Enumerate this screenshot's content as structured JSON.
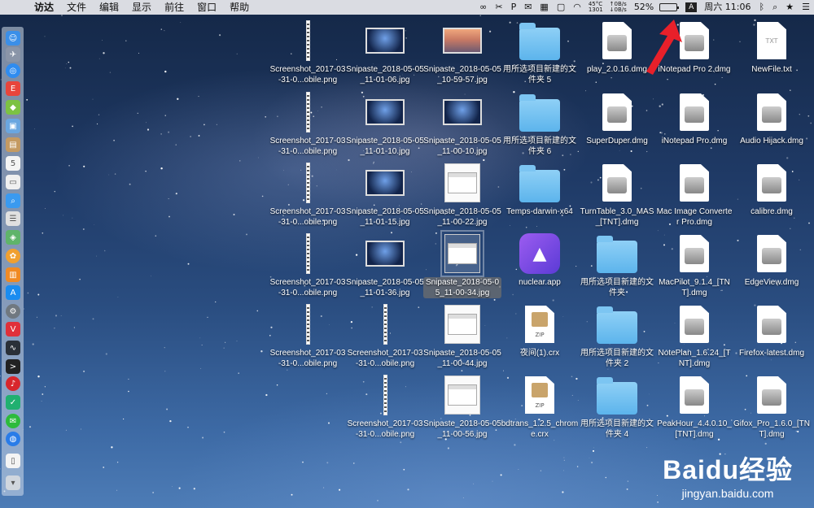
{
  "menubar": {
    "app_name": "访达",
    "menus": [
      "文件",
      "编辑",
      "显示",
      "前往",
      "窗口",
      "帮助"
    ],
    "status": {
      "temp_line1": "45°C",
      "temp_line2": "1301",
      "net_up": "↑0B/s",
      "net_down": "↓0B/s",
      "battery": "52%",
      "battery_level": 0.52,
      "input_method": "A",
      "clock": "周六 11:06"
    }
  },
  "desktop": {
    "items": [
      {
        "label": "Screenshot_2017-03-31-0...obile.png",
        "kind": "strip"
      },
      {
        "label": "Snipaste_2018-05-05_11-01-06.jpg",
        "kind": "shot"
      },
      {
        "label": "Snipaste_2018-05-05_10-59-57.jpg",
        "kind": "sierra"
      },
      {
        "label": "用所选项目新建的文件夹 5",
        "kind": "folder"
      },
      {
        "label": "play_2.0.16.dmg",
        "kind": "dmg"
      },
      {
        "label": "iNotepad Pro 2.dmg",
        "kind": "dmg"
      },
      {
        "label": "NewFile.txt",
        "kind": "txt"
      },
      {
        "label": "Screenshot_2017-03-31-0...obile.png",
        "kind": "strip"
      },
      {
        "label": "Snipaste_2018-05-05_11-01-10.jpg",
        "kind": "shot"
      },
      {
        "label": "Snipaste_2018-05-05_11-00-10.jpg",
        "kind": "shot"
      },
      {
        "label": "用所选项目新建的文件夹 6",
        "kind": "folder"
      },
      {
        "label": "SuperDuper.dmg",
        "kind": "dmg"
      },
      {
        "label": "iNotepad Pro.dmg",
        "kind": "dmg"
      },
      {
        "label": "Audio Hijack.dmg",
        "kind": "dmg"
      },
      {
        "label": "Screenshot_2017-03-31-0...obile.png",
        "kind": "strip"
      },
      {
        "label": "Snipaste_2018-05-05_11-01-15.jpg",
        "kind": "shot"
      },
      {
        "label": "Snipaste_2018-05-05_11-00-22.jpg",
        "kind": "doc"
      },
      {
        "label": "Temps-darwin-x64",
        "kind": "folder"
      },
      {
        "label": "TurnTable_3.0_MAS_[TNT].dmg",
        "kind": "dmg"
      },
      {
        "label": "Mac Image Converter Pro.dmg",
        "kind": "dmg"
      },
      {
        "label": "calibre.dmg",
        "kind": "dmg"
      },
      {
        "label": "Screenshot_2017-03-31-0...obile.png",
        "kind": "strip"
      },
      {
        "label": "Snipaste_2018-05-05_11-01-36.jpg",
        "kind": "shot"
      },
      {
        "label": "Snipaste_2018-05-05_11-00-34.jpg",
        "kind": "doc",
        "selected": true
      },
      {
        "label": "nuclear.app",
        "kind": "nuclear"
      },
      {
        "label": "用所选项目新建的文件夹",
        "kind": "folder"
      },
      {
        "label": "MacPilot_9.1.4_[TNT].dmg",
        "kind": "dmg"
      },
      {
        "label": "EdgeView.dmg",
        "kind": "dmg"
      },
      {
        "label": "Screenshot_2017-03-31-0...obile.png",
        "kind": "strip"
      },
      {
        "label": "Screenshot_2017-03-31-0...obile.png",
        "kind": "strip"
      },
      {
        "label": "Snipaste_2018-05-05_11-00-44.jpg",
        "kind": "doc"
      },
      {
        "label": "夜间(1).crx",
        "kind": "zip"
      },
      {
        "label": "用所选项目新建的文件夹 2",
        "kind": "folder"
      },
      {
        "label": "NotePlan_1.6.24_[TNT].dmg",
        "kind": "dmg"
      },
      {
        "label": "Firefox-latest.dmg",
        "kind": "dmg"
      },
      {
        "label": "Screenshot_2017-03-31-0...obile.png",
        "kind": "strip"
      },
      {
        "label": "Snipaste_2018-05-05_11-00-56.jpg",
        "kind": "doc"
      },
      {
        "label": "bdtrans_1.2.5_chrome.crx",
        "kind": "zip"
      },
      {
        "label": "用所选项目新建的文件夹 4",
        "kind": "folder"
      },
      {
        "label": "PeakHour_4.4.0.10_[TNT].dmg",
        "kind": "dmg"
      },
      {
        "label": "Gifox_Pro_1.6.0_[TNT].dmg",
        "kind": "dmg"
      }
    ]
  },
  "watermark": {
    "logo": "Baidu经验",
    "url": "jingyan.baidu.com"
  },
  "colors": {
    "arrow": "#e8202a",
    "folder": "#6cc0f0"
  }
}
